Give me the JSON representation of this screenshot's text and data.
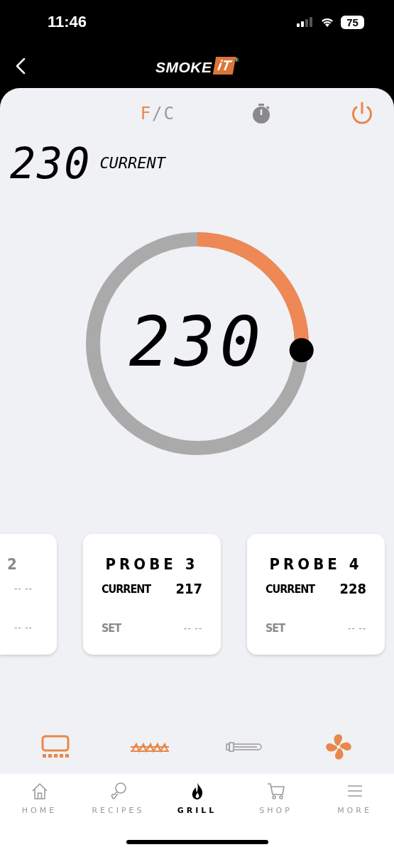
{
  "status_bar": {
    "time": "11:46",
    "battery": "75"
  },
  "header": {
    "logo_main": "SMOKE",
    "logo_badge": "iT",
    "logo_mark": "®"
  },
  "toolbar": {
    "units": [
      {
        "label": "F",
        "selected": true
      },
      {
        "label": "C",
        "selected": false
      }
    ],
    "unit_separator": "/",
    "power_on": true
  },
  "current": {
    "value": "230",
    "label": "CURRENT"
  },
  "dial": {
    "value": "230"
  },
  "probes": [
    {
      "kind": "clipped",
      "title": "2",
      "current_value": "-- --",
      "set_value": "-- --"
    },
    {
      "kind": "full",
      "title": "PROBE 3",
      "current_label": "CURRENT",
      "current_value": "217",
      "set_label": "SET",
      "set_value": "-- --"
    },
    {
      "kind": "full",
      "title": "PROBE 4",
      "current_label": "CURRENT",
      "current_value": "228",
      "set_label": "SET",
      "set_value": "-- --"
    }
  ],
  "devices": [
    {
      "kind": "grill",
      "on": true
    },
    {
      "kind": "auger",
      "on": true
    },
    {
      "kind": "igniter",
      "on": false
    },
    {
      "kind": "fan",
      "on": true
    }
  ],
  "tabs": [
    {
      "kind": "home",
      "label": "HOME",
      "selected": false
    },
    {
      "kind": "recipes",
      "label": "RECIPES",
      "selected": false
    },
    {
      "kind": "grill",
      "label": "GRILL",
      "selected": true
    },
    {
      "kind": "shop",
      "label": "SHOP",
      "selected": false
    },
    {
      "kind": "more",
      "label": "MORE",
      "selected": false
    }
  ]
}
